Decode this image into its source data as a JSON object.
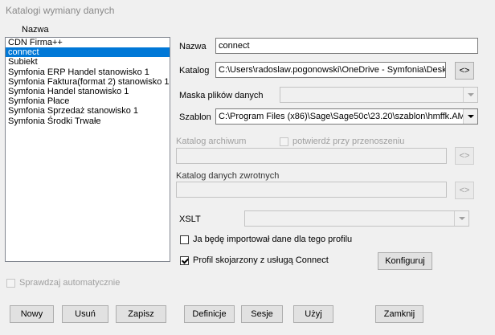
{
  "group_title": "Katalogi wymiany danych",
  "list": {
    "header": "Nazwa",
    "items": [
      {
        "label": "CDN Firma++",
        "selected": false
      },
      {
        "label": "connect",
        "selected": true
      },
      {
        "label": "Subiekt",
        "selected": false
      },
      {
        "label": "Symfonia ERP Handel stanowisko 1",
        "selected": false
      },
      {
        "label": "Symfonia Faktura(format 2) stanowisko 1",
        "selected": false
      },
      {
        "label": "Symfonia Handel stanowisko 1",
        "selected": false
      },
      {
        "label": "Symfonia Płace",
        "selected": false
      },
      {
        "label": "Symfonia Sprzedaż stanowisko 1",
        "selected": false
      },
      {
        "label": "Symfonia Środki Trwałe",
        "selected": false
      }
    ]
  },
  "form": {
    "nazwa_label": "Nazwa",
    "nazwa_value": "connect",
    "katalog_label": "Katalog",
    "katalog_value": "C:\\Users\\radoslaw.pogonowski\\OneDrive - Symfonia\\Desk",
    "browse_label": "<>",
    "maska_label": "Maska plików danych",
    "maska_value": "",
    "szablon_label": "Szablon",
    "szablon_value": "C:\\Program Files (x86)\\Sage\\Sage50c\\23.20\\szablon\\hmffk.AM",
    "archiwum_label": "Katalog archiwum",
    "archiwum_value": "",
    "potwierdz_label": "potwierdź przy przenoszeniu",
    "zwrotny_label": "Katalog danych zwrotnych",
    "zwrotny_value": "",
    "xslt_label": "XSLT",
    "xslt_value": "",
    "import_label": "Ja będę importował dane dla tego profilu",
    "import_checked": false,
    "connect_label": "Profil skojarzony z usługą Connect",
    "connect_checked": true,
    "konfiguruj_label": "Konfiguruj"
  },
  "sprawdzaj_label": "Sprawdzaj automatycznie",
  "buttons": {
    "nowy": "Nowy",
    "usun": "Usuń",
    "zapisz": "Zapisz",
    "definicje": "Definicje",
    "sesje": "Sesje",
    "uzyj": "Użyj",
    "zamknij": "Zamknij"
  }
}
